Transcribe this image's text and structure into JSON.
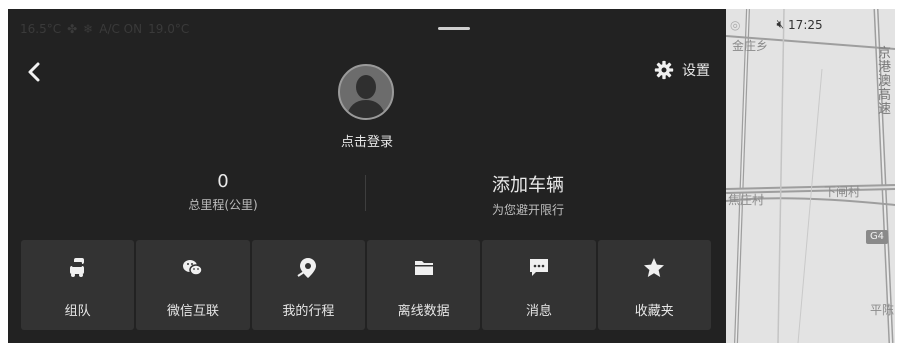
{
  "status": {
    "outside_temp": "16.5°C",
    "ac": "A/C ON",
    "set_temp": "19.0°C",
    "time": "17:25"
  },
  "header": {
    "settings_label": "设置"
  },
  "profile": {
    "login_text": "点击登录"
  },
  "stats": {
    "mileage_value": "0",
    "mileage_label": "总里程(公里)",
    "vehicle_title": "添加车辆",
    "vehicle_sub": "为您避开限行"
  },
  "tiles": [
    {
      "label": "组队",
      "icon": "car-team-icon"
    },
    {
      "label": "微信互联",
      "icon": "wechat-icon"
    },
    {
      "label": "我的行程",
      "icon": "trip-pin-icon"
    },
    {
      "label": "离线数据",
      "icon": "folder-icon"
    },
    {
      "label": "消息",
      "icon": "message-icon"
    },
    {
      "label": "收藏夹",
      "icon": "star-icon"
    }
  ],
  "map": {
    "town": "金庄乡",
    "highway": "京港澳高速",
    "village1": "焦庄村",
    "village2": "下闸村",
    "road_badge": "G4",
    "edge_label": "平陈"
  }
}
